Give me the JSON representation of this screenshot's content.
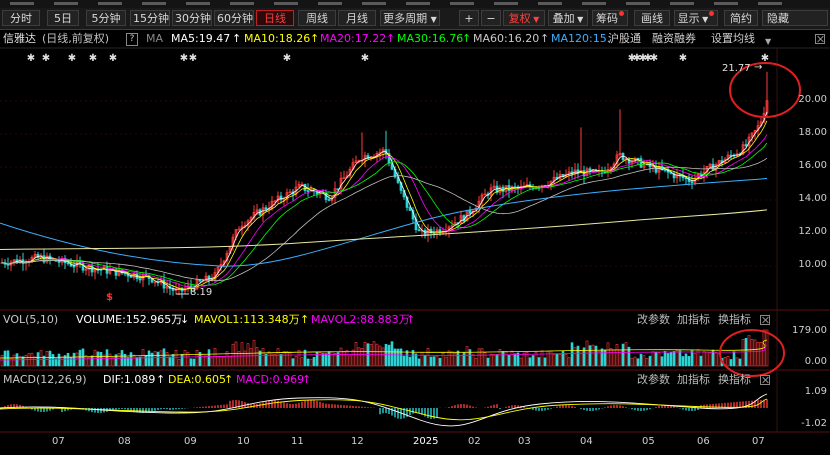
{
  "toolbar": {
    "periods": [
      "分时",
      "5日",
      "5分钟",
      "15分钟",
      "30分钟",
      "60分钟",
      "日线",
      "周线",
      "月线",
      "更多周期"
    ],
    "active_period": "日线",
    "plus": "+",
    "minus": "−",
    "adjust": "复权",
    "overlay": "叠加",
    "chips": "筹码",
    "draw": "画线",
    "display": "显示",
    "simple": "简约",
    "hide": "隐藏"
  },
  "stock": {
    "name": "信雅达",
    "mode": "(日线,前复权)",
    "help": "?",
    "ma_label": "MA",
    "ma5": "MA5:19.47",
    "ma10": "MA10:18.26",
    "ma20": "MA20:17.22",
    "ma30": "MA30:16.76",
    "ma60": "MA60:16.20",
    "ma120": "MA120:15.",
    "hk_connect": "沪股通",
    "margin": "融资融券",
    "set_ma": "设置均线"
  },
  "price_axis": [
    "20.00",
    "18.00",
    "16.00",
    "14.00",
    "12.00",
    "10.00"
  ],
  "high_label": "21.77",
  "low_label": "8.19",
  "low_marker": "$",
  "vol_panel": {
    "label": "VOL(5,10)",
    "volume": "VOLUME:152.965万",
    "mavol1": "MAVOL1:113.348万",
    "mavol2": "MAVOL2:88.883万",
    "params": "改参数",
    "add": "加指标",
    "switch": "换指标",
    "axis": [
      "179.00",
      "0.00"
    ]
  },
  "macd_panel": {
    "label": "MACD(12,26,9)",
    "dif": "DIF:1.089",
    "dea": "DEA:0.605",
    "macd": "MACD:0.969",
    "axis": [
      "1.09",
      "-1.02"
    ]
  },
  "x_axis": [
    "07",
    "08",
    "09",
    "10",
    "11",
    "12",
    "2025",
    "02",
    "03",
    "04",
    "05",
    "06",
    "07"
  ],
  "colors": {
    "up": "#ff3b3b",
    "down": "#2ad4d4",
    "ma5": "#ffffff",
    "ma10": "#ffff00",
    "ma20": "#ff00ff",
    "ma30": "#00ff00",
    "ma60": "#c0c0c0",
    "ma120": "#3ab0ff",
    "ma250": "#e8e8a0",
    "annotation": "#e02020"
  }
}
